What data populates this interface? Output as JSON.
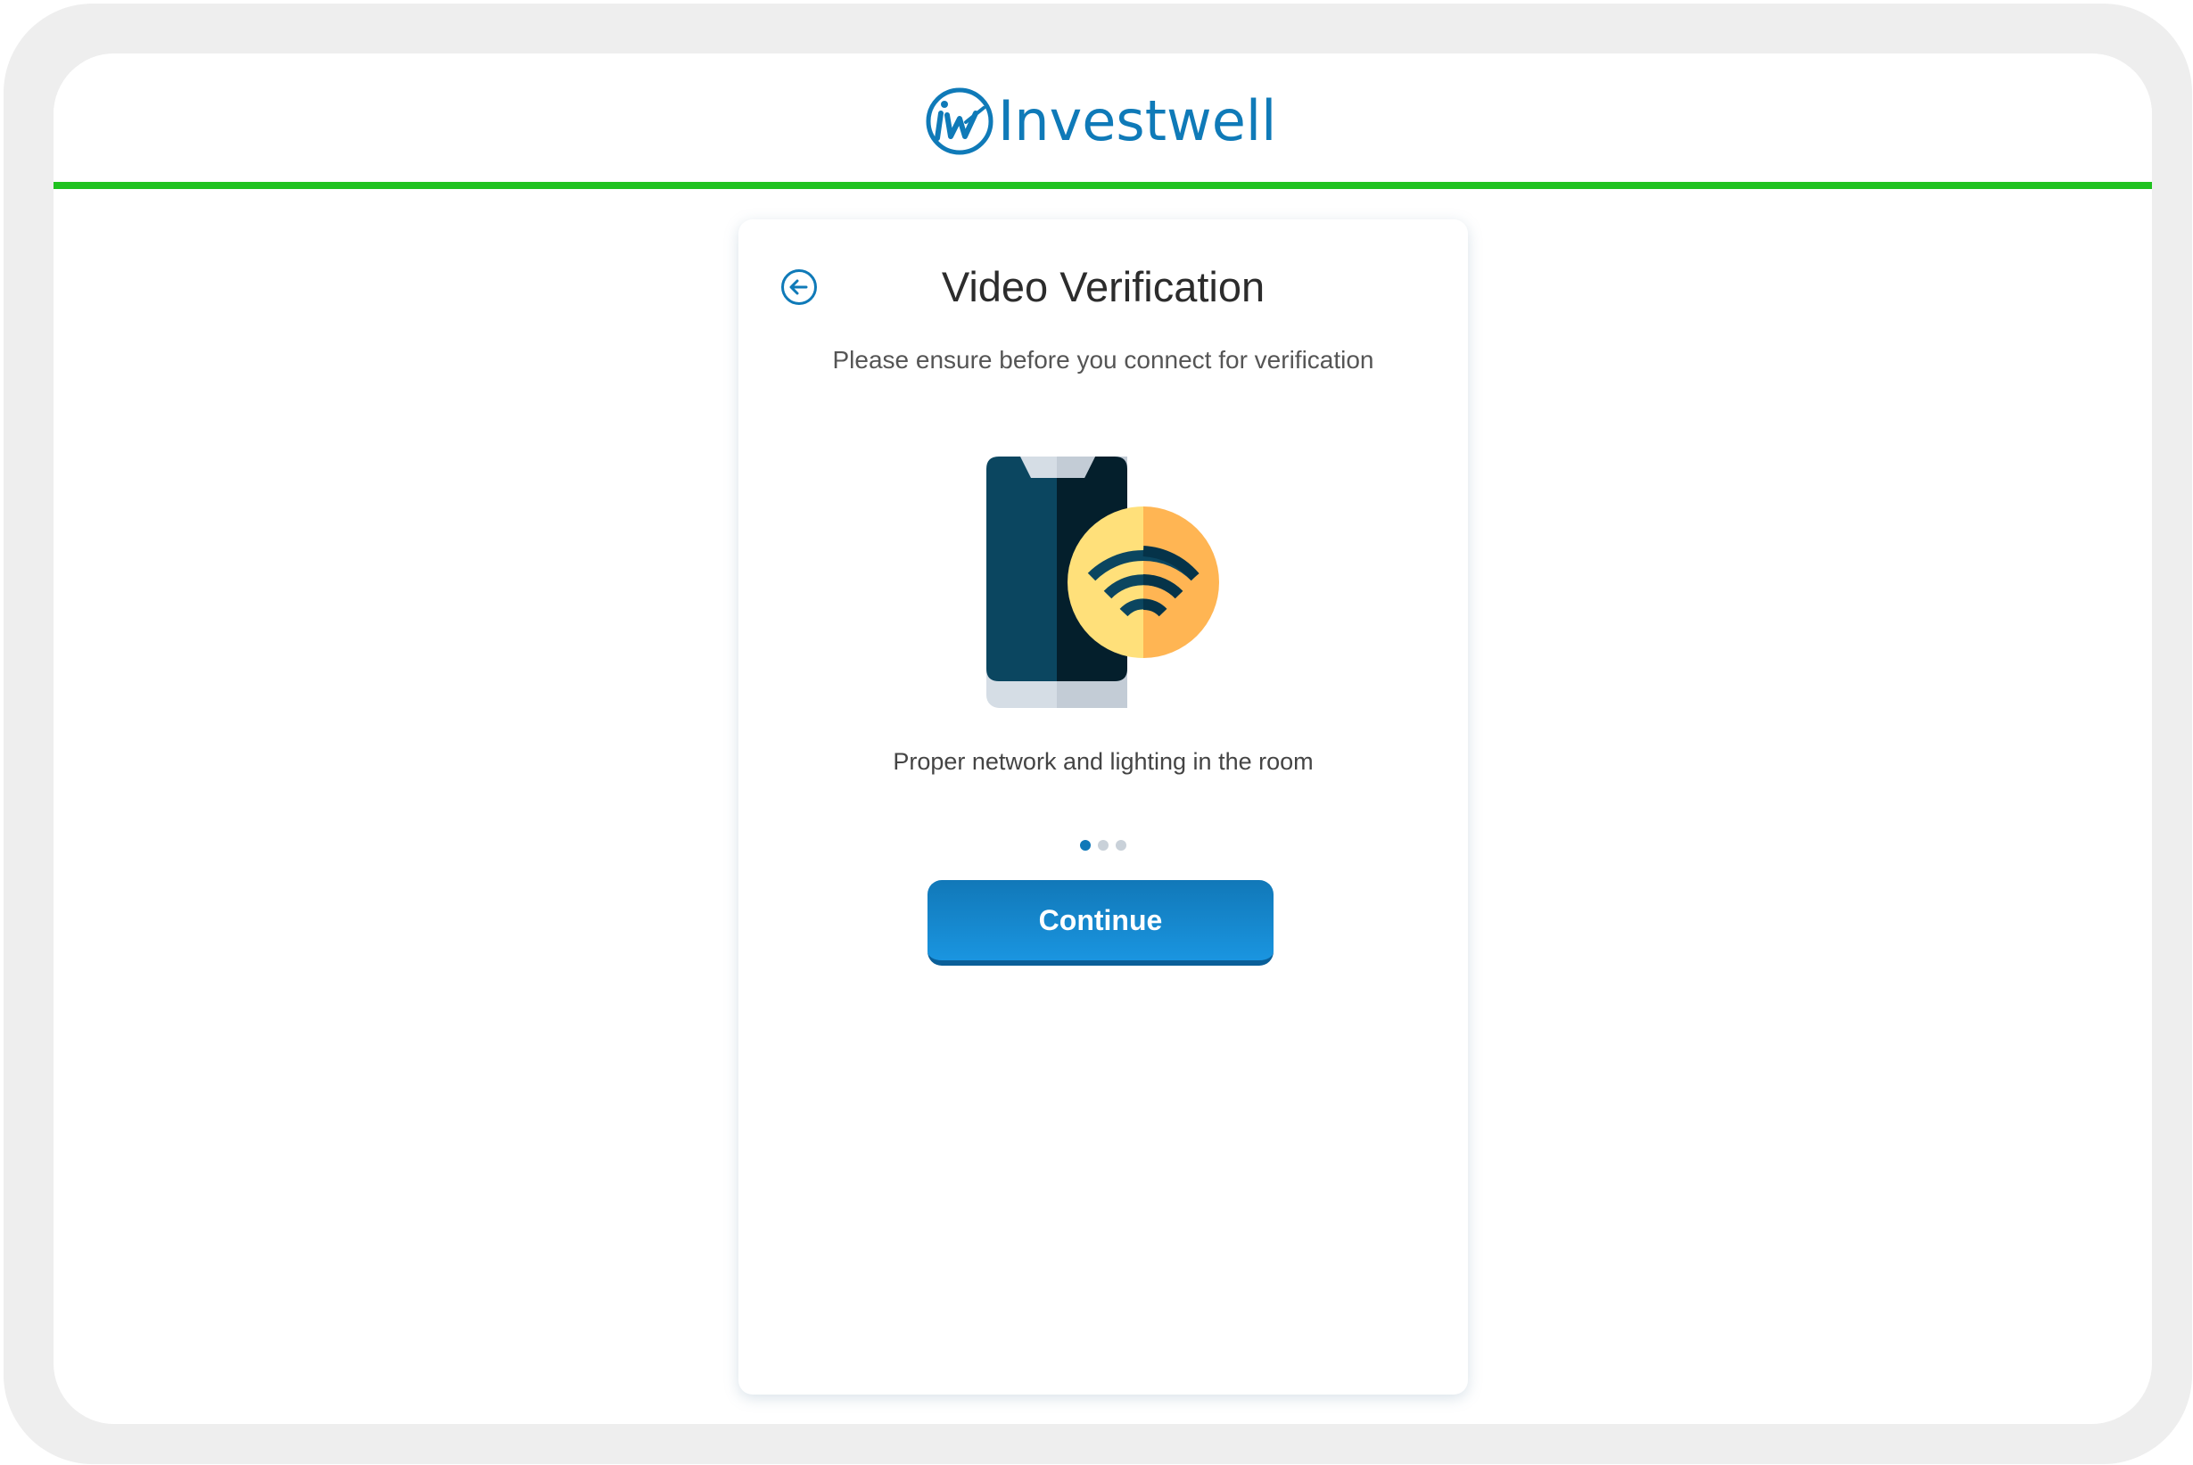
{
  "brand": {
    "name": "Investwell",
    "mark": "iw",
    "color": "#0f7ab8"
  },
  "progress_color": "#1fc21f",
  "page": {
    "title": "Video Verification",
    "subtitle": "Please ensure before you connect for verification",
    "back_icon": "arrow-left-circle-icon"
  },
  "slide": {
    "illustration": "phone-wifi-icon",
    "caption": "Proper network and lighting in the room",
    "current_index": 1,
    "total": 3
  },
  "actions": {
    "continue_label": "Continue",
    "button_color": "#1586cc"
  }
}
